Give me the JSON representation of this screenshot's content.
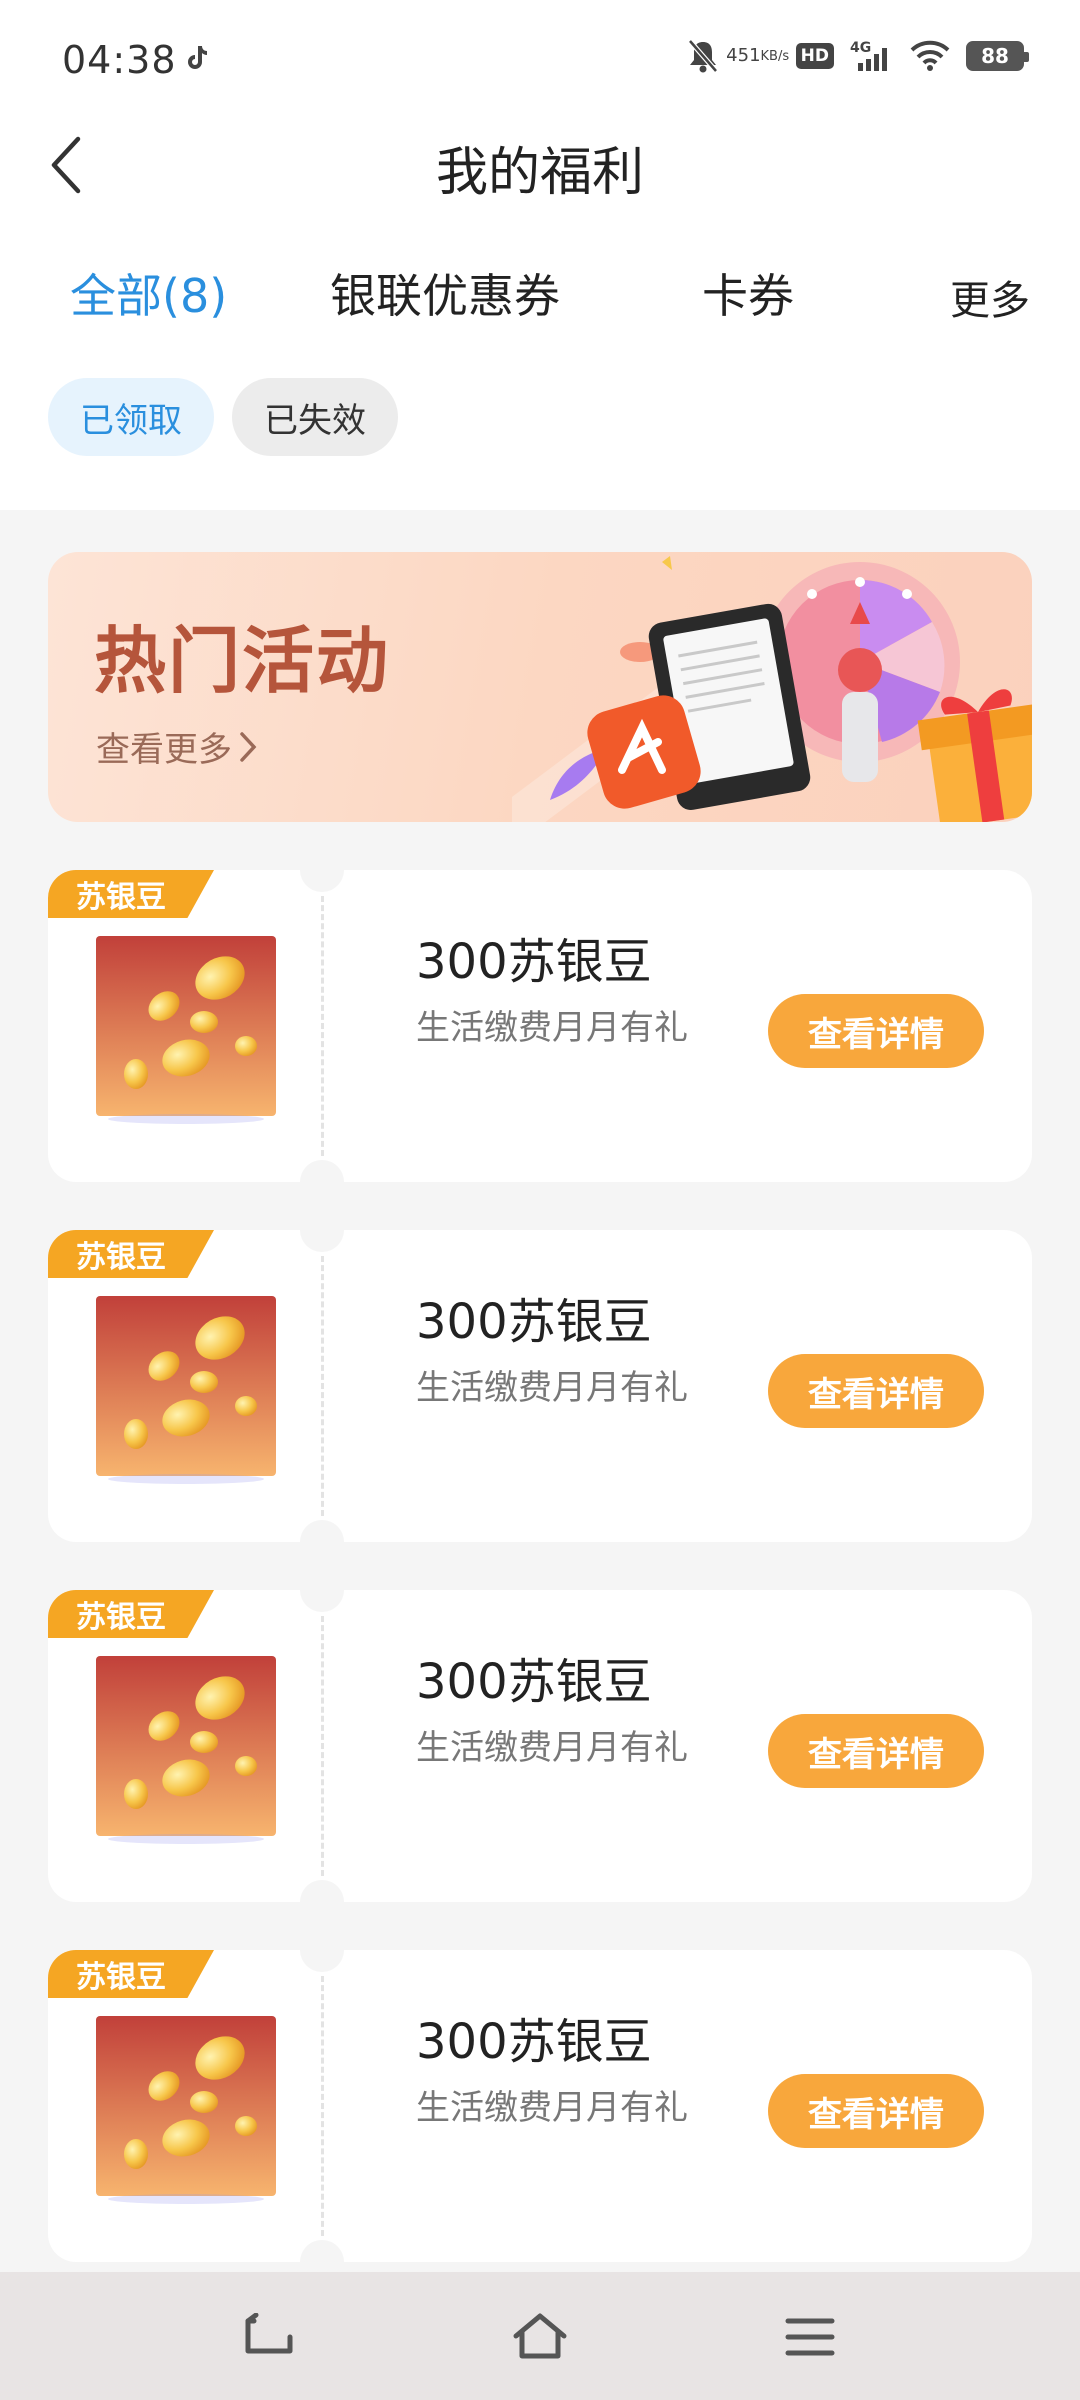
{
  "status_bar": {
    "time": "04:38",
    "net_speed_value": "451",
    "net_speed_unit": "KB/s",
    "hd_label": "HD",
    "network_label": "4G",
    "battery_level": "88"
  },
  "header": {
    "title": "我的福利"
  },
  "tabs": [
    {
      "label": "全部(8)",
      "active": true
    },
    {
      "label": "银联优惠券",
      "active": false
    },
    {
      "label": "卡券",
      "active": false
    },
    {
      "label": "更多",
      "active": false
    }
  ],
  "filters": [
    {
      "label": "已领取",
      "active": true
    },
    {
      "label": "已失效",
      "active": false
    }
  ],
  "banner": {
    "title": "热门活动",
    "link_label": "查看更多"
  },
  "cards": [
    {
      "tag": "苏银豆",
      "title": "300苏银豆",
      "subtitle": "生活缴费月月有礼",
      "button": "查看详情"
    },
    {
      "tag": "苏银豆",
      "title": "300苏银豆",
      "subtitle": "生活缴费月月有礼",
      "button": "查看详情"
    },
    {
      "tag": "苏银豆",
      "title": "300苏银豆",
      "subtitle": "生活缴费月月有礼",
      "button": "查看详情"
    },
    {
      "tag": "苏银豆",
      "title": "300苏银豆",
      "subtitle": "生活缴费月月有礼",
      "button": "查看详情"
    }
  ],
  "colors": {
    "accent_blue": "#2a8fde",
    "button_orange": "#f8a73c",
    "tag_orange": "#f5a623",
    "banner_text": "#b5553b"
  }
}
